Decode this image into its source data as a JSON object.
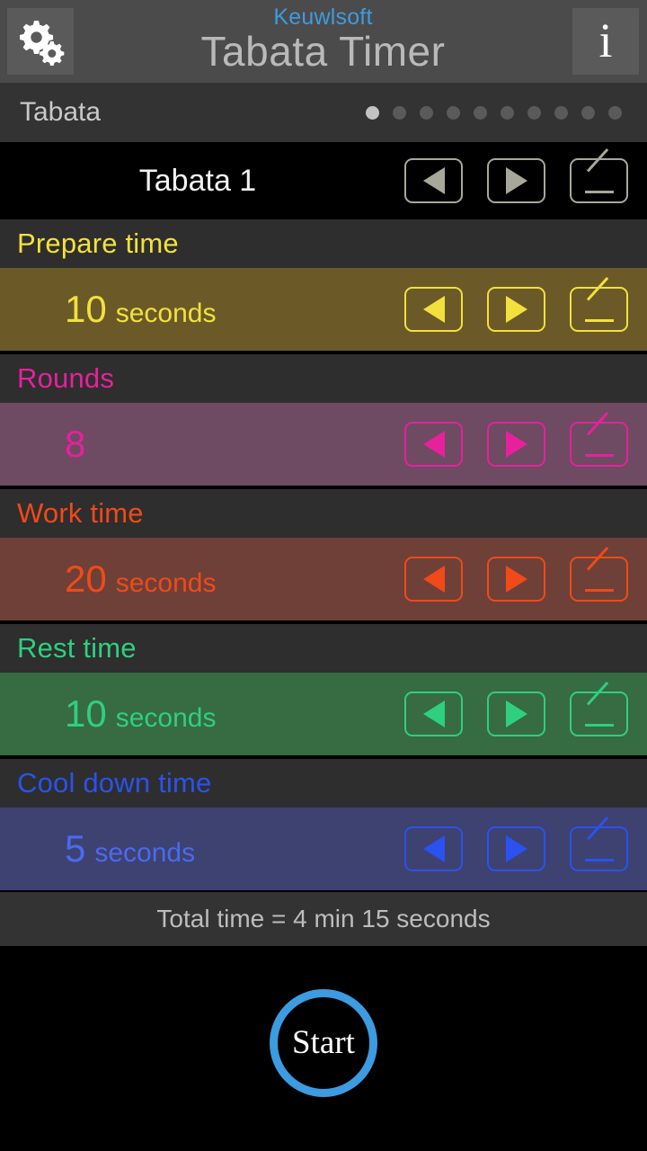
{
  "header": {
    "brand": "Keuwlsoft",
    "title": "Tabata Timer",
    "settings_icon": "gears-icon",
    "info_icon": "info-icon",
    "info_glyph": "i",
    "bar_bg": "#4b4b4b",
    "brand_color": "#3d9be0"
  },
  "selector": {
    "label": "Tabata",
    "dot_count": 10,
    "active_index": 0,
    "active_color": "#c3c3c3",
    "inactive_color": "#5a5a5a"
  },
  "preset": {
    "name": "Tabata 1",
    "prev_label": "◀",
    "next_label": "▶",
    "edit_label": "edit",
    "control_color": "#a8a89a"
  },
  "sections": [
    {
      "id": "prepare-time",
      "label": "Prepare time",
      "value": "10",
      "unit": "seconds",
      "accent": "#f2e13c",
      "body_bg": "#6b5a28",
      "head_bg": "#2e2e2e"
    },
    {
      "id": "rounds",
      "label": "Rounds",
      "value": "8",
      "unit": "",
      "accent": "#e6219b",
      "body_bg": "#6e4a63",
      "head_bg": "#2e2e2e"
    },
    {
      "id": "work-time",
      "label": "Work time",
      "value": "20",
      "unit": "seconds",
      "accent": "#f04a18",
      "body_bg": "#6e4038",
      "head_bg": "#2e2e2e"
    },
    {
      "id": "rest-time",
      "label": "Rest time",
      "value": "10",
      "unit": "seconds",
      "accent": "#2fcf80",
      "body_bg": "#376b41",
      "head_bg": "#2e2e2e"
    },
    {
      "id": "cool-down-time",
      "label": "Cool down time",
      "value": "5",
      "unit": "seconds",
      "accent": "#2b51f0",
      "body_bg": "#3d4270",
      "head_bg": "#2e2e2e",
      "value_color": "#4a6af0"
    }
  ],
  "footer": {
    "total_time": "Total time = 4 min 15 seconds",
    "start_label": "Start",
    "start_color": "#3d9be0"
  }
}
